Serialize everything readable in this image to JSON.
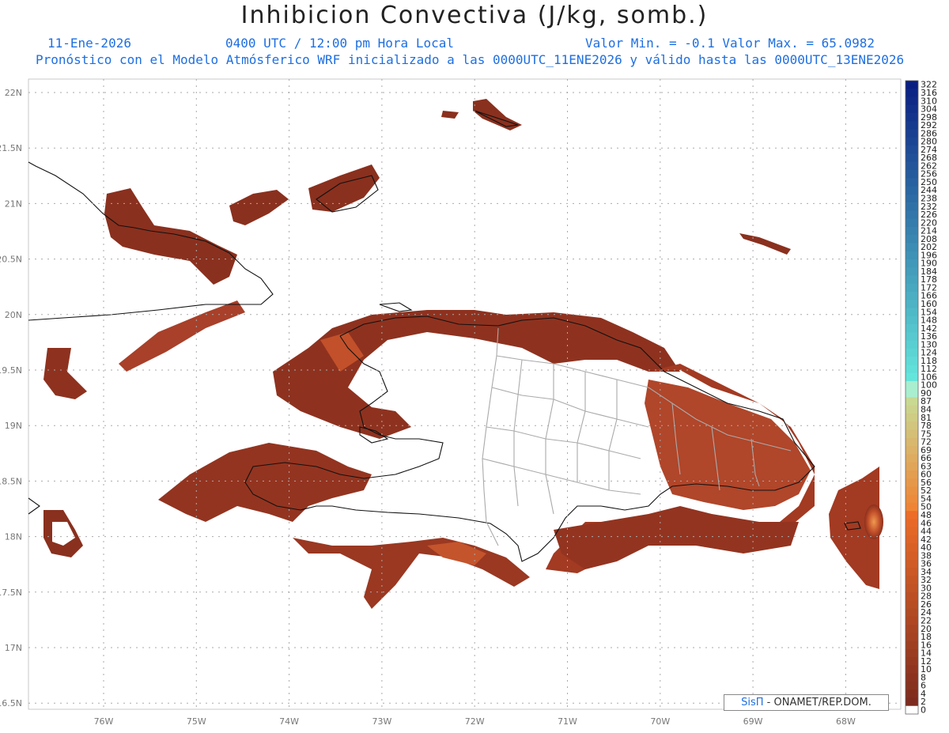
{
  "title": "Inhibicion Convectiva (J/kg, somb.)",
  "header": {
    "date": "11-Ene-2026",
    "time": "0400 UTC / 12:00 pm Hora Local",
    "min_max": "Valor Min. = -0.1  Valor Max. = 65.0982",
    "model_line": "Pronóstico con el Modelo Atmósferico WRF inicializado a las 0000UTC_11ENE2026 y válido hasta las  0000UTC_13ENE2026"
  },
  "map": {
    "lon_ticks": [
      "76W",
      "75W",
      "74W",
      "73W",
      "72W",
      "71W",
      "70W",
      "69W",
      "68W"
    ],
    "lat_ticks": [
      "22N",
      "21.5N",
      "21N",
      "20.5N",
      "20N",
      "19.5N",
      "19N",
      "18.5N",
      "18N",
      "17.5N",
      "17N",
      "16.5N"
    ],
    "lon_range": [
      -76.8,
      -67.6
    ],
    "lat_range": [
      16.45,
      22.05
    ],
    "grid": true
  },
  "colorbar": {
    "labels": [
      "322",
      "316",
      "310",
      "304",
      "298",
      "292",
      "286",
      "280",
      "274",
      "268",
      "262",
      "256",
      "250",
      "244",
      "238",
      "232",
      "226",
      "220",
      "214",
      "208",
      "202",
      "196",
      "190",
      "184",
      "178",
      "172",
      "166",
      "160",
      "154",
      "148",
      "142",
      "136",
      "130",
      "124",
      "118",
      "112",
      "106",
      "100",
      "90",
      "87",
      "84",
      "81",
      "78",
      "75",
      "72",
      "69",
      "66",
      "63",
      "60",
      "56",
      "52",
      "54",
      "50",
      "48",
      "46",
      "44",
      "42",
      "40",
      "38",
      "36",
      "34",
      "32",
      "30",
      "28",
      "26",
      "24",
      "22",
      "20",
      "18",
      "16",
      "14",
      "12",
      "10",
      "8",
      "6",
      "4",
      "2",
      "0"
    ]
  },
  "credit": {
    "brand": "SisΠ",
    "text": " - ONAMET/REP.DOM."
  },
  "colors": {
    "field_dark": "#7a2a1c",
    "field_mid": "#a33a22",
    "field_bright": "#d0582c",
    "blue_text": "#1e6fe0"
  }
}
